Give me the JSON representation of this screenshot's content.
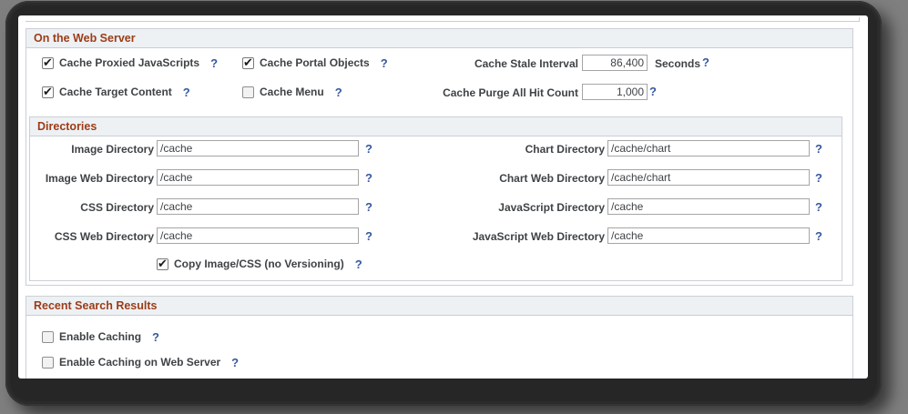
{
  "ui": {
    "help_glyph": "?"
  },
  "colors": {
    "header_text": "#9c3c17",
    "header_bg": "#eef1f4",
    "box_border": "#cbd0d6",
    "help_blue": "#3558a0",
    "frame_dark": "#262626",
    "desktop_gray": "#7f7f7f"
  },
  "sections": {
    "web_server": {
      "title": "On the Web Server",
      "checkboxes": [
        {
          "label": "Cache Proxied JavaScripts",
          "checked": true
        },
        {
          "label": "Cache Portal Objects",
          "checked": true
        },
        {
          "label": "Cache Target Content",
          "checked": true
        },
        {
          "label": "Cache Menu",
          "checked": false
        }
      ],
      "fields": [
        {
          "label": "Cache Stale Interval",
          "value": "86,400",
          "unit": "Seconds"
        },
        {
          "label": "Cache Purge All Hit Count",
          "value": "1,000"
        }
      ]
    },
    "directories": {
      "title": "Directories",
      "left_fields": [
        {
          "label": "Image Directory",
          "value": "/cache"
        },
        {
          "label": "Image Web Directory",
          "value": "/cache"
        },
        {
          "label": "CSS Directory",
          "value": "/cache"
        },
        {
          "label": "CSS Web Directory",
          "value": "/cache"
        }
      ],
      "right_fields": [
        {
          "label": "Chart Directory",
          "value": "/cache/chart"
        },
        {
          "label": "Chart Web Directory",
          "value": "/cache/chart"
        },
        {
          "label": "JavaScript Directory",
          "value": "/cache"
        },
        {
          "label": "JavaScript Web Directory",
          "value": "/cache"
        }
      ],
      "copy_checkbox": {
        "label": "Copy Image/CSS (no Versioning)",
        "checked": true
      }
    },
    "recent_search": {
      "title": "Recent Search Results",
      "checkboxes": [
        {
          "label": "Enable Caching",
          "checked": false
        },
        {
          "label": "Enable Caching on Web Server",
          "checked": false
        }
      ]
    }
  }
}
